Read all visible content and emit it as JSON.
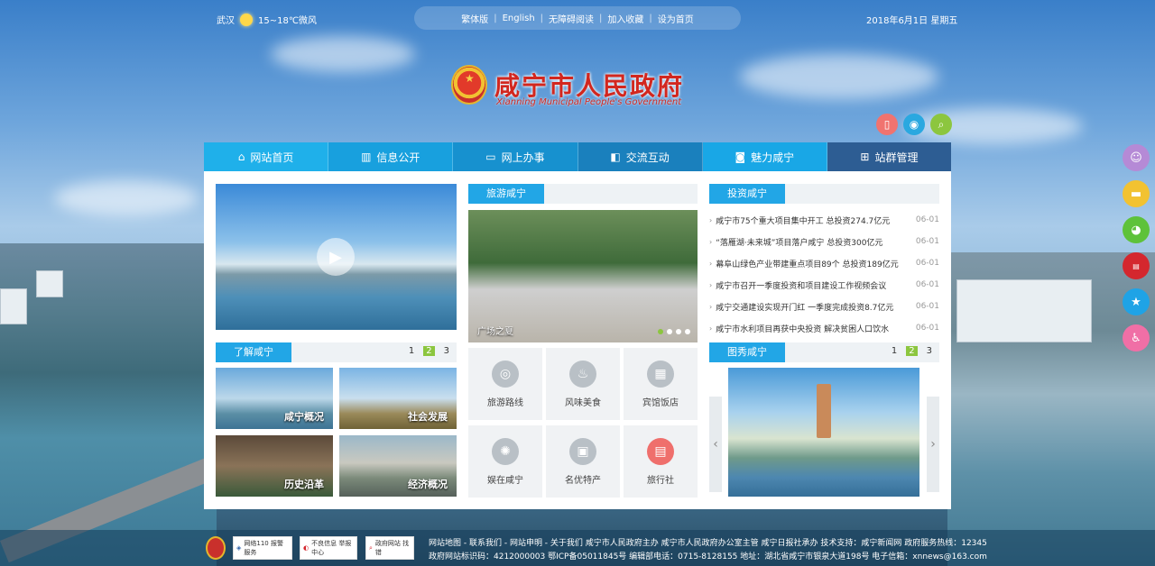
{
  "weather": {
    "city": "武汉",
    "desc": "15~18℃微风",
    "icon": "sun-icon"
  },
  "top_links": [
    "繁体版",
    "English",
    "无障碍阅读",
    "加入收藏",
    "设为首页"
  ],
  "date": "2018年6月1日 星期五",
  "logo": {
    "title": "咸宁市人民政府",
    "subtitle": "Xianning Municipal People's Government",
    "emblem": "national-emblem-icon"
  },
  "header_buttons": [
    {
      "icon": "mobile-icon",
      "color": "#f0736f"
    },
    {
      "icon": "weibo-icon",
      "color": "#2aa8e0"
    },
    {
      "icon": "search-icon",
      "color": "#8cc63f"
    }
  ],
  "nav": [
    {
      "label": "网站首页",
      "icon": "home-icon",
      "bg": "#1fb0ea"
    },
    {
      "label": "信息公开",
      "icon": "book-icon",
      "bg": "#18a0de"
    },
    {
      "label": "网上办事",
      "icon": "monitor-icon",
      "bg": "#1791cf"
    },
    {
      "label": "交流互动",
      "icon": "chat-icon",
      "bg": "#1a80bd"
    },
    {
      "label": "魅力咸宁",
      "icon": "camera-icon",
      "bg": "#19a7e6"
    },
    {
      "label": "站群管理",
      "icon": "sitemap-icon",
      "bg": "#2d5d93"
    }
  ],
  "sections": {
    "know": {
      "title": "了解咸宁",
      "pages": [
        "1",
        "2",
        "3"
      ],
      "active": "2",
      "tiles": [
        "咸宁概况",
        "社会发展",
        "历史沿革",
        "经济概况"
      ]
    },
    "travel": {
      "title": "旅游咸宁",
      "photo_caption": "广场之夏"
    },
    "invest": {
      "title": "投资咸宁",
      "news": [
        {
          "title": "咸宁市75个重大项目集中开工 总投资274.7亿元",
          "date": "06-01"
        },
        {
          "title": "“落雁湖·未来城”项目落户咸宁 总投资300亿元",
          "date": "06-01"
        },
        {
          "title": "幕阜山绿色产业带建重点项目89个 总投资189亿元",
          "date": "06-01"
        },
        {
          "title": "咸宁市召开一季度投资和项目建设工作视频会议",
          "date": "06-01"
        },
        {
          "title": "咸宁交通建设实现开门红 一季度完成投资8.7亿元",
          "date": "06-01"
        },
        {
          "title": "咸宁市水利项目再获中央投资 解决贫困人口饮水",
          "date": "06-01"
        }
      ]
    },
    "gallery": {
      "title": "图秀咸宁",
      "pages": [
        "1",
        "2",
        "3"
      ],
      "active": "2"
    }
  },
  "services": [
    {
      "label": "旅游路线",
      "icon": "route-icon"
    },
    {
      "label": "风味美食",
      "icon": "food-icon"
    },
    {
      "label": "宾馆饭店",
      "icon": "hotel-icon"
    },
    {
      "label": "娱在咸宁",
      "icon": "camera-aperture-icon"
    },
    {
      "label": "名优特产",
      "icon": "gift-icon"
    },
    {
      "label": "旅行社",
      "icon": "travel-agency-icon"
    }
  ],
  "float_buttons": [
    {
      "icon": "user-icon",
      "color": "#b58ad6"
    },
    {
      "icon": "message-icon",
      "color": "#f2c231"
    },
    {
      "icon": "wechat-icon",
      "color": "#5ec23a"
    },
    {
      "icon": "newspaper-icon",
      "color": "#d4272e"
    },
    {
      "icon": "star-icon",
      "color": "#1fa3e6"
    },
    {
      "icon": "accessibility-icon",
      "color": "#f06fa6"
    }
  ],
  "footer": {
    "badges": [
      "网络110 报警服务",
      "不良信息 举报中心",
      "政府网站 找错"
    ],
    "line1": "网站地图 - 联系我们 - 网站申明 - 关于我们    咸宁市人民政府主办    咸宁市人民政府办公室主管    咸宁日报社承办    技术支持：咸宁新闻网    政府服务热线：12345",
    "line2": "政府网站标识码：4212000003    鄂ICP备05011845号    编辑部电话：0715-8128155    地址：湖北省咸宁市银泉大道198号    电子信箱：xnnews@163.com"
  }
}
